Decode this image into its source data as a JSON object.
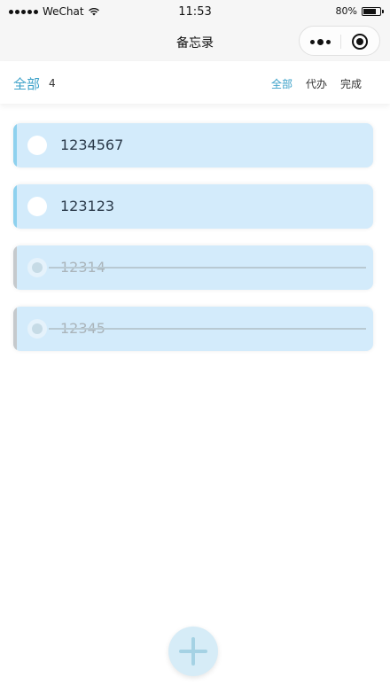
{
  "status_bar": {
    "carrier": "WeChat",
    "time": "11:53",
    "battery_text": "80%",
    "battery_level": 0.8
  },
  "nav": {
    "title": "备忘录"
  },
  "filter": {
    "current_label": "全部",
    "count": "4",
    "tabs": [
      {
        "label": "全部",
        "active": true
      },
      {
        "label": "代办",
        "active": false
      },
      {
        "label": "完成",
        "active": false
      }
    ]
  },
  "todos": [
    {
      "text": "1234567",
      "completed": false
    },
    {
      "text": "123123",
      "completed": false
    },
    {
      "text": "12314",
      "completed": true
    },
    {
      "text": "12345",
      "completed": true
    }
  ],
  "colors": {
    "accent": "#3aa0c8",
    "item_background": "#d3ebfb",
    "active_bar": "#8ed1ee",
    "done_bar": "#c5c9cc"
  },
  "icons": {
    "add": "plus-icon",
    "capsule_more": "more-dots-icon",
    "capsule_close": "close-target-icon",
    "wifi": "wifi-icon",
    "battery": "battery-icon"
  }
}
